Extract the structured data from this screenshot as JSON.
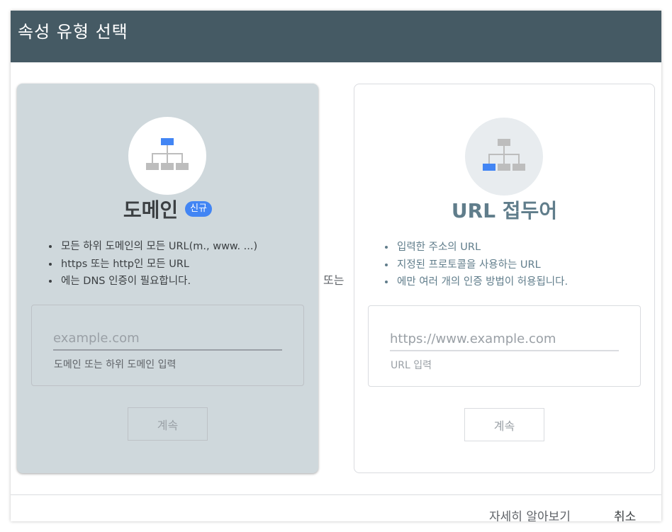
{
  "dialog": {
    "title": "속성 유형 선택"
  },
  "domain_card": {
    "icon": "sitemap-icon",
    "title": "도메인",
    "badge": "신규",
    "bullets": [
      "모든 하위 도메인의 모든 URL(m., www. ...)",
      "https 또는 http인 모든 URL",
      "에는 DNS 인증이 필요합니다."
    ],
    "input": {
      "value": "",
      "placeholder": "example.com",
      "helper": "도메인 또는 하위 도메인 입력"
    },
    "continue_label": "계속"
  },
  "separator": {
    "label": "또는"
  },
  "url_card": {
    "icon": "sitemap-icon",
    "title": "URL 접두어",
    "bullets": [
      "입력한 주소의 URL",
      "지정된 프로토콜을 사용하는 URL",
      "에만 여러 개의 인증 방법이 허용됩니다."
    ],
    "input": {
      "value": "",
      "placeholder": "https://www.example.com",
      "helper": "URL 입력"
    },
    "continue_label": "계속"
  },
  "footer": {
    "learn_more_label": "자세히 알아보기",
    "cancel_label": "취소"
  },
  "colors": {
    "header": "#455a64",
    "accent": "#4285f4",
    "selected_card": "#cfd8dc"
  }
}
